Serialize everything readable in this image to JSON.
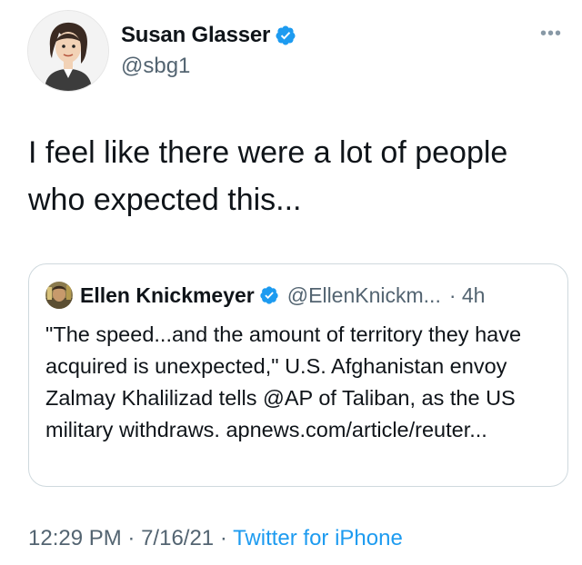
{
  "author": {
    "name": "Susan Glasser",
    "handle": "@sbg1",
    "verified": true,
    "avatar_icon": "profile-illustration-icon"
  },
  "more_label": "•••",
  "tweet": {
    "text": "I feel like there were a lot of people who expected this..."
  },
  "quoted": {
    "name": "Ellen Knickmeyer",
    "handle": "@EllenKnickm...",
    "time": "· 4h",
    "verified": true,
    "text": "\"The speed...and the amount of territory they have acquired is unexpected,\" U.S. Afghanistan envoy Zalmay Khalilizad tells @AP of Taliban, as the US military withdraws. apnews.com/article/reuter..."
  },
  "meta": {
    "time": "12:29 PM",
    "date": "7/16/21",
    "separator": "·",
    "source": "Twitter for iPhone"
  },
  "colors": {
    "accent": "#1d9bf0",
    "secondary_text": "#536471",
    "border": "#cfd9de"
  }
}
